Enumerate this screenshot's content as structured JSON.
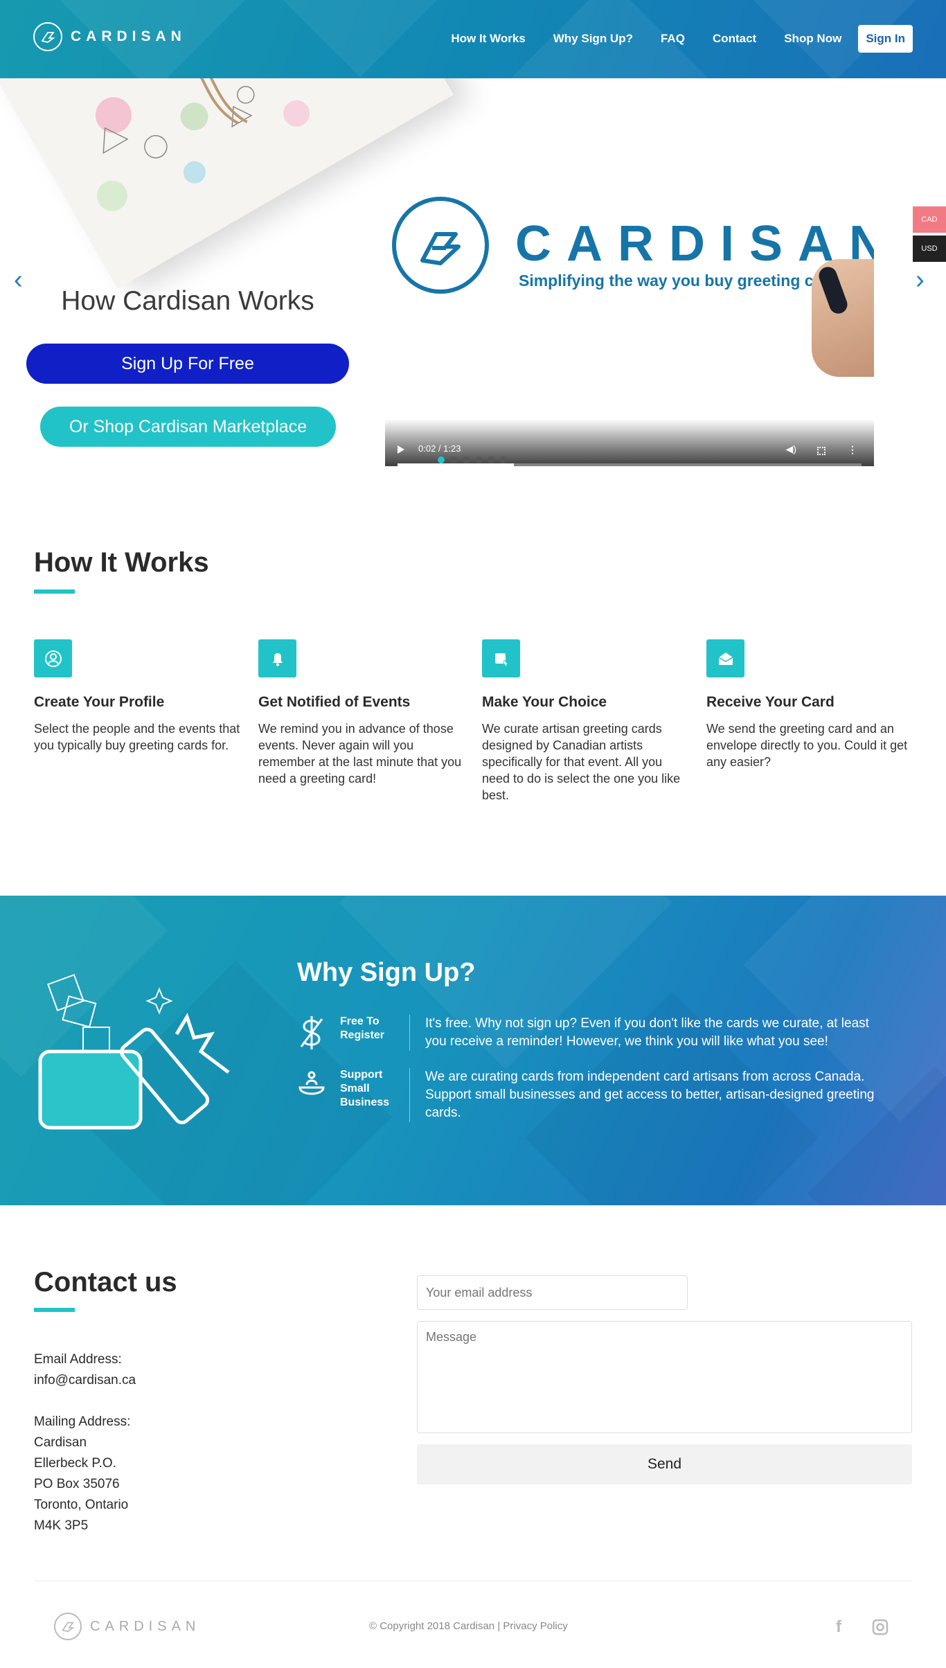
{
  "brand": {
    "name": "CARDISAN"
  },
  "nav": {
    "items": [
      "How It Works",
      "Why Sign Up?",
      "FAQ",
      "Contact",
      "Shop Now"
    ],
    "signin": "Sign In"
  },
  "currency": {
    "cad": "CAD",
    "usd": "USD"
  },
  "hero": {
    "title": "How Cardisan Works",
    "signup_button": "Sign Up For Free",
    "shop_button": "Or Shop Cardisan Marketplace",
    "video": {
      "brand": "CARDISAN",
      "tagline": "Simplifying the way you buy greeting ca",
      "time": "0:02 / 1:23",
      "progress": 0.25
    },
    "slides": 6,
    "active_slide": 0
  },
  "how": {
    "title": "How It Works",
    "steps": [
      {
        "icon": "profile-icon",
        "title": "Create Your Profile",
        "text": "Select the people and the events that you typically buy greeting cards for."
      },
      {
        "icon": "bell-icon",
        "title": "Get Notified of Events",
        "text": "We remind you in advance of those events. Never again will you remember at the last minute that you need a greeting card!"
      },
      {
        "icon": "card-choice-icon",
        "title": "Make Your Choice",
        "text": "We curate artisan greeting cards designed by Canadian artists specifically for that event. All you need to do is select the one you like best."
      },
      {
        "icon": "envelope-icon",
        "title": "Receive Your Card",
        "text": "We send the greeting card and an envelope directly to you. Could it get any easier?"
      }
    ]
  },
  "why": {
    "title": "Why Sign Up?",
    "rows": [
      {
        "icon": "dollar-icon",
        "label": "Free To Register",
        "text": "It's free. Why not sign up? Even if you don't like the cards we curate, at least you receive a reminder! However, we think you will like what you see!"
      },
      {
        "icon": "support-icon",
        "label": "Support Small Business",
        "text": "We are curating cards from independent card artisans from across Canada. Support small businesses and get access to better, artisan-designed greeting cards."
      }
    ]
  },
  "contact": {
    "title": "Contact us",
    "email_label": "Email Address:",
    "email": "info@cardisan.ca",
    "mail_label": "Mailing Address:",
    "address": [
      "Cardisan",
      "Ellerbeck P.O.",
      "PO Box 35076",
      "Toronto, Ontario",
      "M4K 3P5"
    ],
    "email_placeholder": "Your email address",
    "message_placeholder": "Message",
    "send": "Send"
  },
  "footer": {
    "brand": "CARDISAN",
    "copyright": "© Copyright 2018 Cardisan | ",
    "privacy": "Privacy Policy",
    "social": [
      "facebook-icon",
      "instagram-icon"
    ]
  },
  "colors": {
    "accent": "#21c3c8",
    "primary": "#1020c6",
    "brand_blue": "#1675a8"
  }
}
